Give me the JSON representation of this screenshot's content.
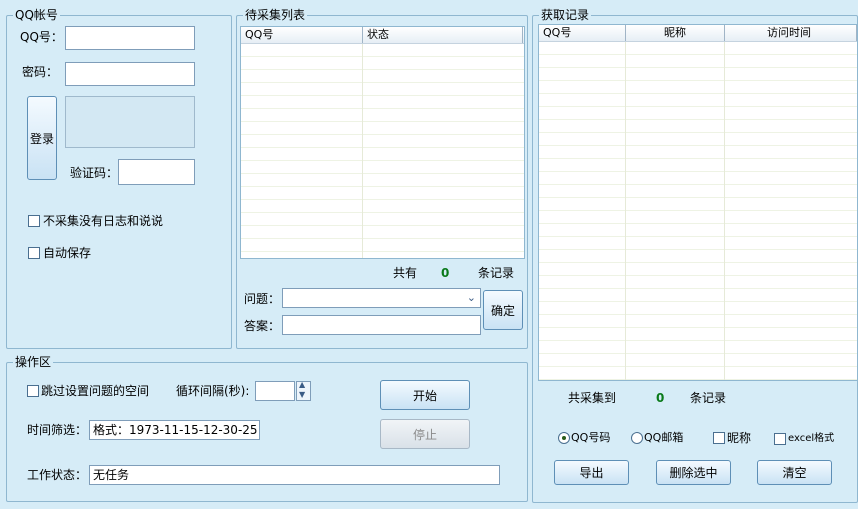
{
  "qq_account": {
    "title": "QQ帐号",
    "qq_label": "QQ号：",
    "qq_value": "",
    "password_label": "密码：",
    "password_value": "",
    "login_button": "登录",
    "captcha_label": "验证码：",
    "captcha_value": "",
    "skip_no_blog_label": "不采集没有日志和说说",
    "auto_save_label": "自动保存"
  },
  "pending_list": {
    "title": "待采集列表",
    "columns": [
      "QQ号",
      "状态"
    ],
    "total_prefix": "共有",
    "total_count": "0",
    "total_suffix": "条记录",
    "question_label": "问题：",
    "question_value": "",
    "answer_label": "答案：",
    "answer_value": "",
    "confirm_button": "确定"
  },
  "records": {
    "title": "获取记录",
    "columns": [
      "QQ号",
      "昵称",
      "访问时间"
    ],
    "total_prefix": "共采集到",
    "total_count": "0",
    "total_suffix": "条记录",
    "opt_qq_number": "QQ号码",
    "opt_qq_mail": "QQ邮箱",
    "opt_nickname": "昵称",
    "opt_excel": "excel格式",
    "export_button": "导出",
    "delete_selected_button": "删除选中",
    "clear_button": "清空"
  },
  "operation": {
    "title": "操作区",
    "skip_question_label": "跳过设置问题的空间",
    "interval_label": "循环间隔(秒):",
    "interval_value": "",
    "start_button": "开始",
    "stop_button": "停止",
    "time_filter_label": "时间筛选：",
    "time_filter_value": "格式：1973-11-15-12-30-25",
    "work_status_label": "工作状态：",
    "work_status_value": "无任务"
  }
}
